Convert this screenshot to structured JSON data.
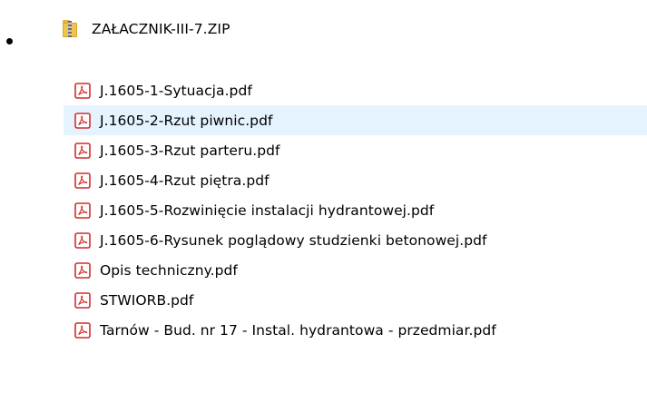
{
  "archive": {
    "name": "ZAŁACZNIK-III-7.ZIP",
    "icon": "zip-folder-icon"
  },
  "files": [
    {
      "name": "J.1605-1-Sytuacja.pdf",
      "icon": "pdf-icon",
      "hovered": false
    },
    {
      "name": "J.1605-2-Rzut piwnic.pdf",
      "icon": "pdf-icon",
      "hovered": true
    },
    {
      "name": "J.1605-3-Rzut parteru.pdf",
      "icon": "pdf-icon",
      "hovered": false
    },
    {
      "name": "J.1605-4-Rzut piętra.pdf",
      "icon": "pdf-icon",
      "hovered": false
    },
    {
      "name": "J.1605-5-Rozwinięcie instalacji hydrantowej.pdf",
      "icon": "pdf-icon",
      "hovered": false
    },
    {
      "name": "J.1605-6-Rysunek poglądowy studzienki betonowej.pdf",
      "icon": "pdf-icon",
      "hovered": false
    },
    {
      "name": "Opis techniczny.pdf",
      "icon": "pdf-icon",
      "hovered": false
    },
    {
      "name": "STWIORB.pdf",
      "icon": "pdf-icon",
      "hovered": false
    },
    {
      "name": "Tarnów - Bud. nr 17 - Instal. hydrantowa - przedmiar.pdf",
      "icon": "pdf-icon",
      "hovered": false
    }
  ],
  "colors": {
    "hover_background": "#e5f3ff",
    "pdf_red": "#d42a2a",
    "zip_yellow": "#f0c44c"
  }
}
